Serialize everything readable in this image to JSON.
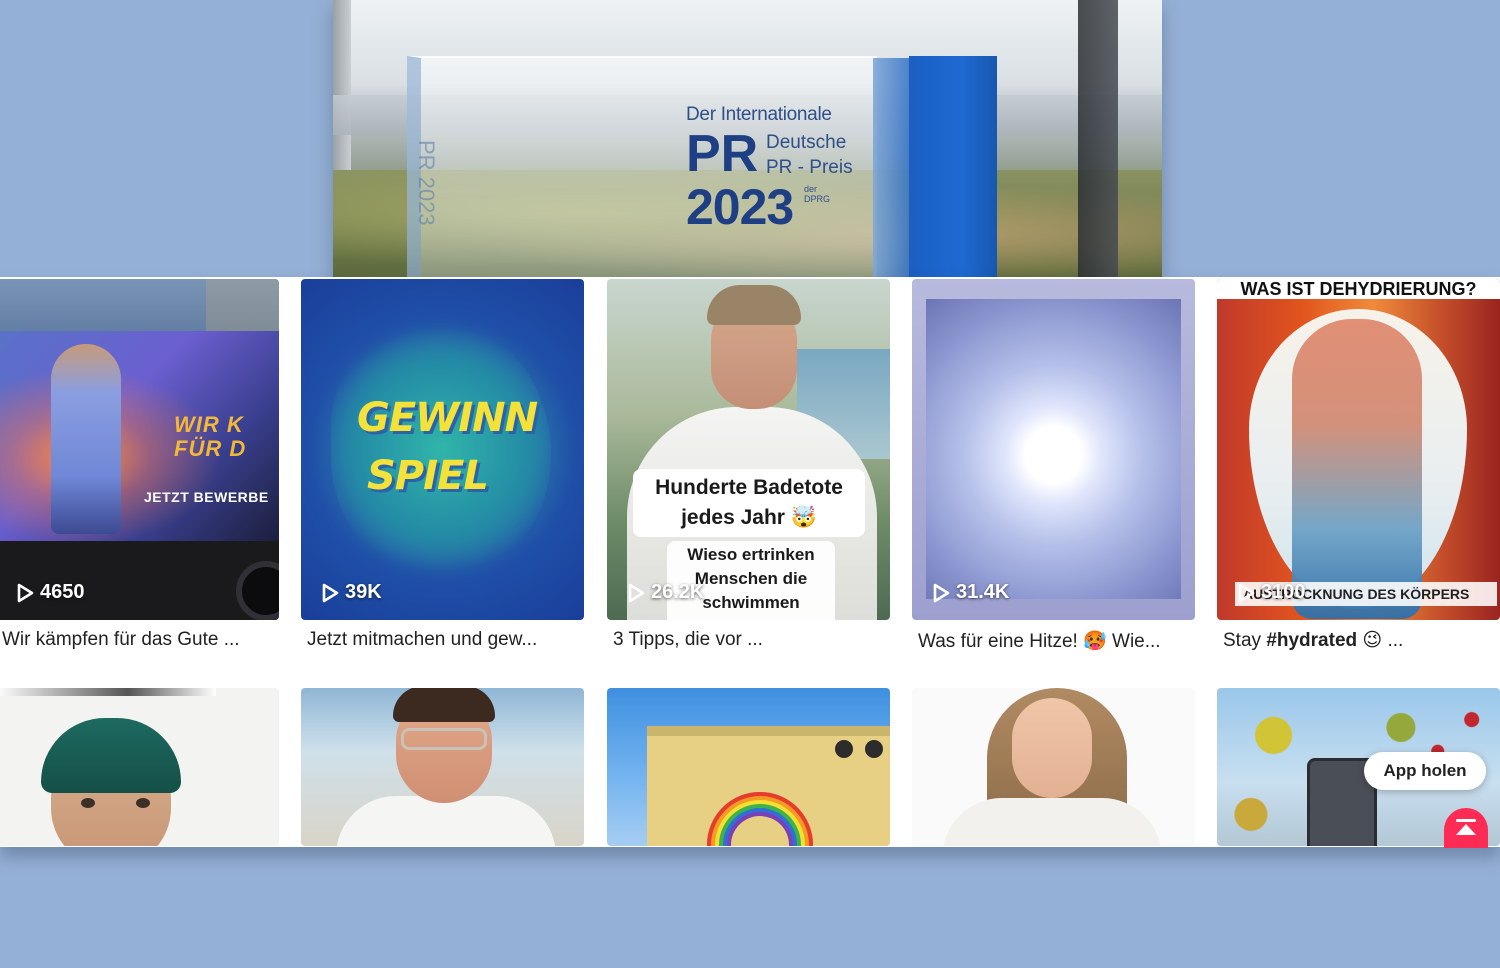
{
  "hero": {
    "engraving_line1": "Der Internationale",
    "engraving_pr": "PR",
    "engraving_line2": "Deutsche",
    "engraving_line3": "PR - Preis",
    "engraving_year": "2023",
    "engraving_org": "der DPRG",
    "side_engraving": "PR 2023"
  },
  "videos": [
    {
      "views": "4650",
      "caption": "Wir kämpfen für das Gute ...",
      "overlay_slogan_1": "WIR K",
      "overlay_slogan_2": "FÜR D",
      "overlay_sub": "JETZT BEWERBE"
    },
    {
      "views": "39K",
      "caption": "Jetzt mitmachen und gew...",
      "overlay_word_1": "GEWINN",
      "overlay_word_2": "SPIEL"
    },
    {
      "views": "26.2K",
      "caption": "3 Tipps, die vor ...",
      "overlay_bubble_1": "Hunderte Badetote jedes Jahr 🤯",
      "overlay_bubble_2": "Wieso ertrinken Menschen die schwimmen können?"
    },
    {
      "views": "31.4K",
      "caption": "Was für eine Hitze! 🥵 Wie..."
    },
    {
      "views": "3100",
      "caption_prefix": "Stay ",
      "caption_bold": "#hydrated",
      "caption_suffix": " 😉 ...",
      "overlay_title": "WAS IST DEHYDRIERUNG?",
      "overlay_band": "AUSTROCKNUNG DES KÖRPERS"
    }
  ],
  "app_button": "App holen",
  "icons": {
    "play": "play-icon",
    "scroll_top": "arrow-up-icon"
  },
  "colors": {
    "accent": "#fe2c55",
    "background": "#95b0d6"
  }
}
